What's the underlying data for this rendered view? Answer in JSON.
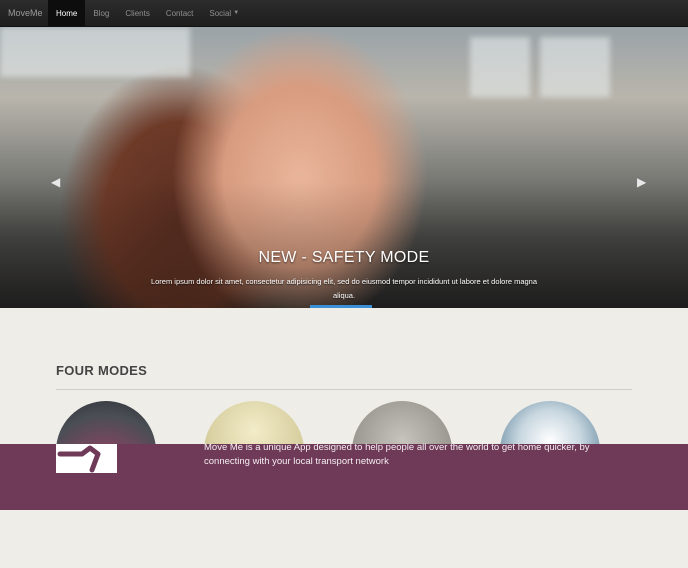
{
  "navbar": {
    "brand": "MoveMe",
    "items": [
      {
        "label": "Home",
        "active": true
      },
      {
        "label": "Blog",
        "active": false
      },
      {
        "label": "Clients",
        "active": false
      },
      {
        "label": "Contact",
        "active": false
      },
      {
        "label": "Social",
        "active": false,
        "dropdown": true
      }
    ]
  },
  "hero": {
    "title": "NEW - SAFETY MODE",
    "text": "Lorem ipsum dolor sit amet, consectetur adipisicing elit, sed do eiusmod tempor incididunt ut labore et dolore magna aliqua.",
    "prev_icon": "chevron-left-icon",
    "next_icon": "chevron-right-icon",
    "indicator_color": "#3a8fd6"
  },
  "modes": {
    "title": "FOUR MODES",
    "items": [
      {
        "image": "city-traffic-photo"
      },
      {
        "image": "power-lines-photo"
      },
      {
        "image": "bare-tree-photo"
      },
      {
        "image": "sky-clouds-photo"
      }
    ]
  },
  "banner": {
    "text": "Move Me is a unique App designed to help people all over the world to get home quicker, by connecting with your local transport network",
    "background_color": "#6f3a58",
    "logo_icon": "moveme-logo-icon"
  }
}
